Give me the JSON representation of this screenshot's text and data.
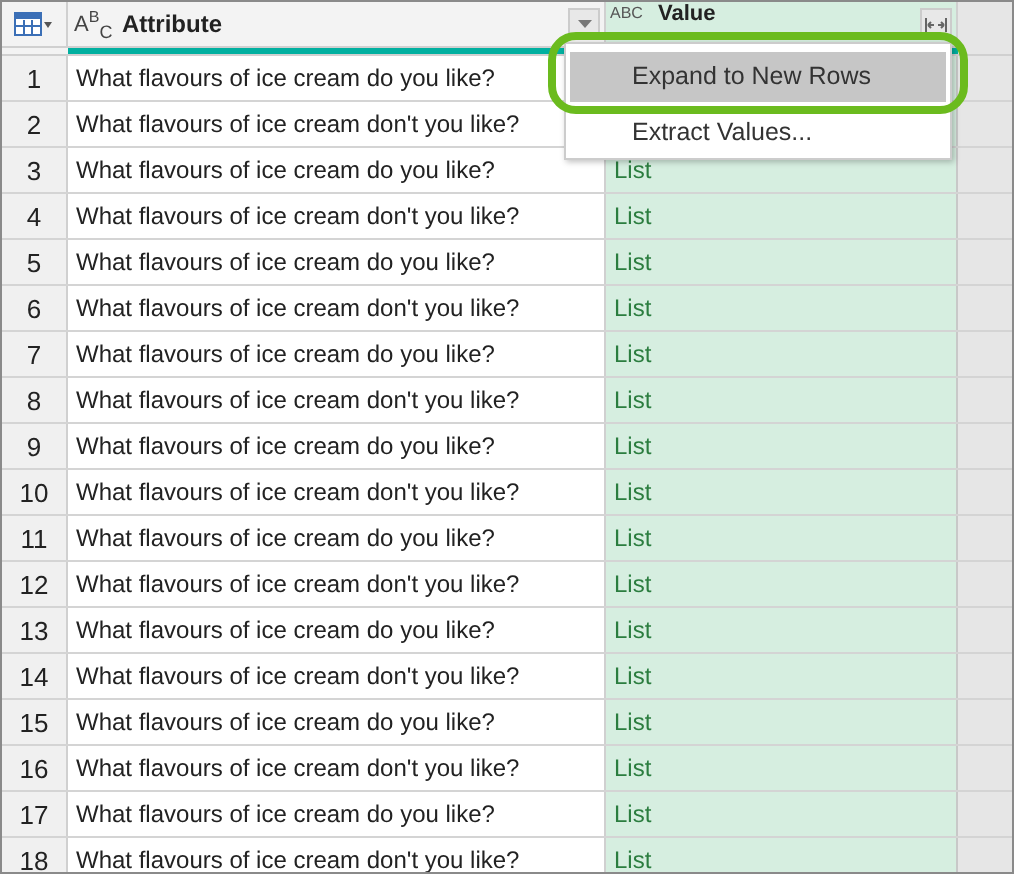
{
  "header": {
    "attribute": {
      "type_icon": "A$^{B}$$_{C}$",
      "label": "Attribute"
    },
    "value": {
      "type_icon": "ABC",
      "label": "Value"
    }
  },
  "rows": [
    {
      "number": "1",
      "attribute": "What flavours of ice cream do you like?"
    },
    {
      "number": "2",
      "attribute": "What flavours of ice cream don't you like?"
    },
    {
      "number": "3",
      "attribute": "What flavours of ice cream do you like?",
      "value": "List"
    },
    {
      "number": "4",
      "attribute": "What flavours of ice cream don't you like?",
      "value": "List"
    },
    {
      "number": "5",
      "attribute": "What flavours of ice cream do you like?",
      "value": "List"
    },
    {
      "number": "6",
      "attribute": "What flavours of ice cream don't you like?",
      "value": "List"
    },
    {
      "number": "7",
      "attribute": "What flavours of ice cream do you like?",
      "value": "List"
    },
    {
      "number": "8",
      "attribute": "What flavours of ice cream don't you like?",
      "value": "List"
    },
    {
      "number": "9",
      "attribute": "What flavours of ice cream do you like?",
      "value": "List"
    },
    {
      "number": "10",
      "attribute": "What flavours of ice cream don't you like?",
      "value": "List"
    },
    {
      "number": "11",
      "attribute": "What flavours of ice cream do you like?",
      "value": "List"
    },
    {
      "number": "12",
      "attribute": "What flavours of ice cream don't you like?",
      "value": "List"
    },
    {
      "number": "13",
      "attribute": "What flavours of ice cream do you like?",
      "value": "List"
    },
    {
      "number": "14",
      "attribute": "What flavours of ice cream don't you like?",
      "value": "List"
    },
    {
      "number": "15",
      "attribute": "What flavours of ice cream do you like?",
      "value": "List"
    },
    {
      "number": "16",
      "attribute": "What flavours of ice cream don't you like?",
      "value": "List"
    },
    {
      "number": "17",
      "attribute": "What flavours of ice cream do you like?",
      "value": "List"
    },
    {
      "number": "18",
      "attribute": "What flavours of ice cream don't you like?",
      "value": "List"
    }
  ],
  "menu": {
    "items": [
      {
        "label": "Expand to New Rows",
        "selected": true
      },
      {
        "label": "Extract Values...",
        "selected": false
      }
    ]
  }
}
